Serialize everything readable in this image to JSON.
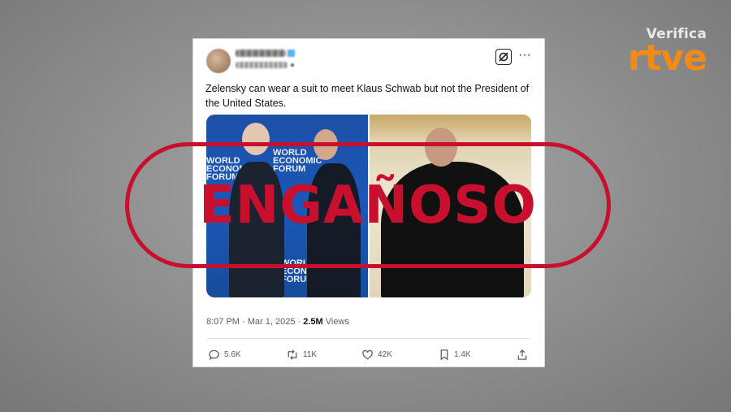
{
  "brand": {
    "top": "Verifica",
    "main": "rtve",
    "accent_color": "#f28a18"
  },
  "post": {
    "text": "Zelensky can wear a suit to meet Klaus Schwab but not the President of the United States.",
    "timestamp": "8:07 PM · Mar 1, 2025 · ",
    "views_count": "2.5M",
    "views_label": " Views",
    "media": {
      "left_logo_top": "WORLD ECONOMIC FORUM",
      "left_logo_bottom": "WORLD ECONOMIC FORUM"
    },
    "actions": {
      "replies": "5.6K",
      "reposts": "11K",
      "likes": "42K",
      "bookmarks": "1.4K"
    }
  },
  "stamp": {
    "label": "ENGAÑOSO",
    "color": "#c8102e"
  },
  "icons": [
    "grok-icon",
    "more-options-icon",
    "reply-icon",
    "repost-icon",
    "like-icon",
    "bookmark-icon",
    "share-icon"
  ]
}
